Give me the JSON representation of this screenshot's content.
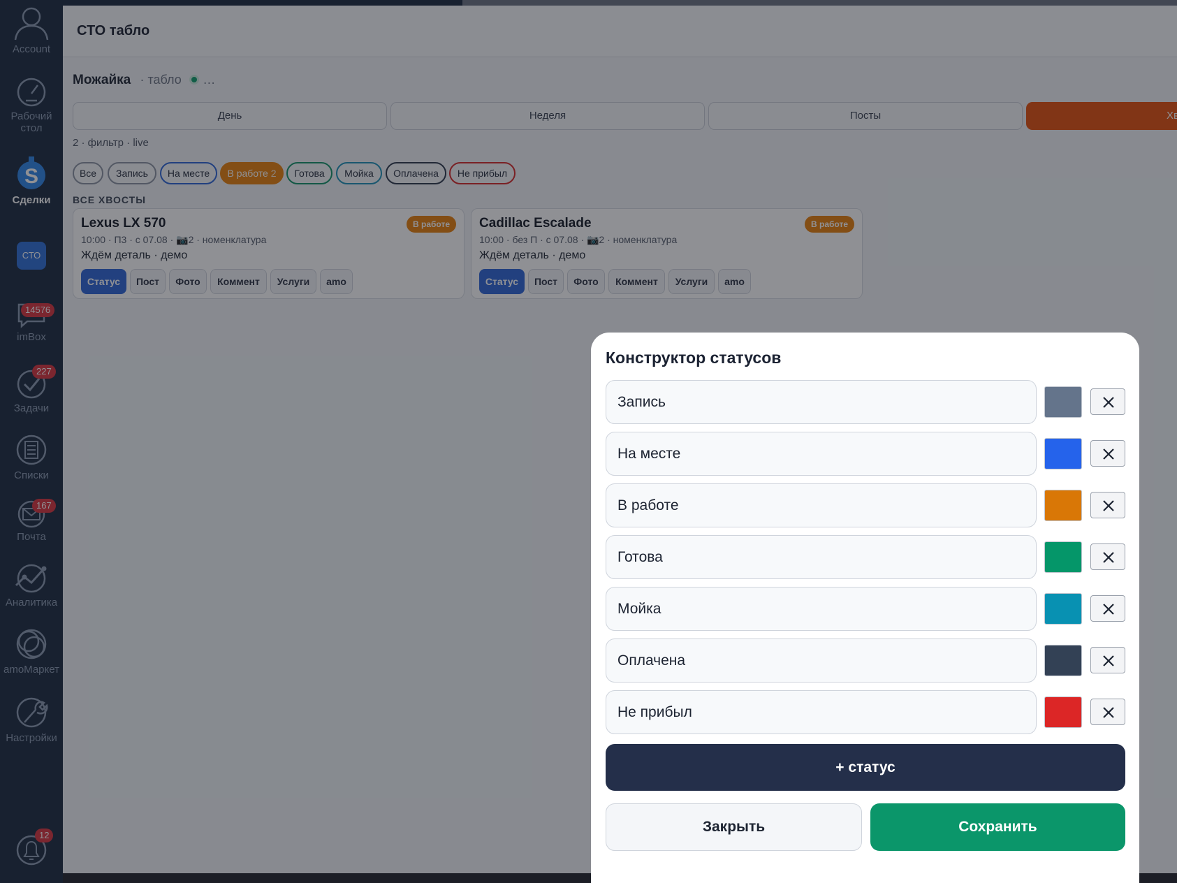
{
  "sidebar": {
    "account": "Account",
    "desk": "Рабочий стол",
    "deals": "Сделки",
    "sto": "СТО",
    "imbox": "imBox",
    "imbox_badge": "14576",
    "tasks": "Задачи",
    "tasks_badge": "227",
    "lists": "Списки",
    "mail": "Почта",
    "mail_badge": "167",
    "analytics": "Аналитика",
    "market": "amoМаркет",
    "settings": "Настройки",
    "notif_badge": "12"
  },
  "window": {
    "title": "СТО табло"
  },
  "crumb": {
    "name": "Можайка",
    "suffix": "· табло",
    "more": "…"
  },
  "view_tabs": [
    "День",
    "Неделя",
    "Посты",
    "Хв"
  ],
  "filter_info": "2 · фильтр · live",
  "chips": {
    "all": "Все",
    "record": "Запись",
    "onsite": "На месте",
    "inwork": "В работе",
    "inwork_count": "2",
    "ready": "Готова",
    "wash": "Мойка",
    "paid": "Оплачена",
    "noshow": "Не прибыл"
  },
  "section_label": "ВСЕ ХВОСТЫ",
  "cards": [
    {
      "title": "Lexus LX 570",
      "meta": "10:00 · П3 · с 07.08 · 📷2 · номенклатура",
      "note": "Ждём деталь · демо",
      "badge": "В работе",
      "actions": [
        "Статус",
        "Пост",
        "Фото",
        "Коммент",
        "Услуги",
        "amo"
      ]
    },
    {
      "title": "Cadillac Escalade",
      "meta": "10:00 · без П · с 07.08 · 📷2 · номенклатура",
      "note": "Ждём деталь · демо",
      "badge": "В работе",
      "actions": [
        "Статус",
        "Пост",
        "Фото",
        "Коммент",
        "Услуги",
        "amo"
      ]
    }
  ],
  "modal": {
    "title": "Конструктор статусов",
    "statuses": [
      {
        "name": "Запись",
        "color": "#64748b"
      },
      {
        "name": "На месте",
        "color": "#2563eb"
      },
      {
        "name": "В работе",
        "color": "#d97706"
      },
      {
        "name": "Готова",
        "color": "#059669"
      },
      {
        "name": "Мойка",
        "color": "#0891b2"
      },
      {
        "name": "Оплачена",
        "color": "#334155"
      },
      {
        "name": "Не прибыл",
        "color": "#dc2626"
      }
    ],
    "add_label": "+ статус",
    "close_label": "Закрыть",
    "save_label": "Сохранить"
  },
  "icons": {
    "account": "account-icon",
    "desk": "speedometer-icon",
    "deals": "dollar-icon",
    "imbox": "chat-icon",
    "tasks": "checkmark-icon",
    "lists": "list-icon",
    "mail": "mail-icon",
    "analytics": "chart-icon",
    "market": "market-icon",
    "settings": "wrench-icon",
    "notifications": "bell-icon",
    "delete": "close-icon"
  }
}
